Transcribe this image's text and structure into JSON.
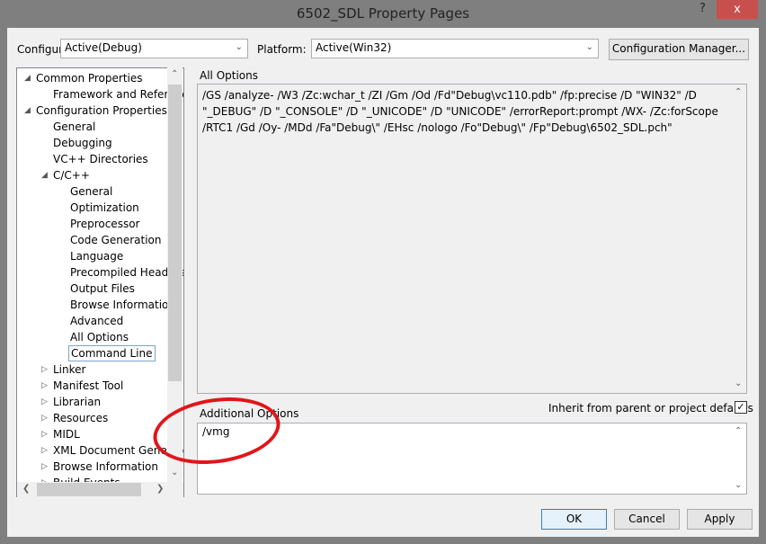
{
  "window": {
    "title": "6502_SDL Property Pages",
    "help": "?",
    "close": "x"
  },
  "toolbar": {
    "configuration_label": "Configuration:",
    "configuration_value": "Active(Debug)",
    "platform_label": "Platform:",
    "platform_value": "Active(Win32)",
    "config_manager": "Configuration Manager..."
  },
  "tree": {
    "items": [
      {
        "label": "Common Properties",
        "level": 0,
        "state": "expanded"
      },
      {
        "label": "Framework and References",
        "level": 1,
        "state": "leaf"
      },
      {
        "label": "Configuration Properties",
        "level": 0,
        "state": "expanded"
      },
      {
        "label": "General",
        "level": 1,
        "state": "leaf"
      },
      {
        "label": "Debugging",
        "level": 1,
        "state": "leaf"
      },
      {
        "label": "VC++ Directories",
        "level": 1,
        "state": "leaf"
      },
      {
        "label": "C/C++",
        "level": 1,
        "state": "expanded"
      },
      {
        "label": "General",
        "level": 2,
        "state": "leaf"
      },
      {
        "label": "Optimization",
        "level": 2,
        "state": "leaf"
      },
      {
        "label": "Preprocessor",
        "level": 2,
        "state": "leaf"
      },
      {
        "label": "Code Generation",
        "level": 2,
        "state": "leaf"
      },
      {
        "label": "Language",
        "level": 2,
        "state": "leaf"
      },
      {
        "label": "Precompiled Headers",
        "level": 2,
        "state": "leaf"
      },
      {
        "label": "Output Files",
        "level": 2,
        "state": "leaf"
      },
      {
        "label": "Browse Information",
        "level": 2,
        "state": "leaf"
      },
      {
        "label": "Advanced",
        "level": 2,
        "state": "leaf"
      },
      {
        "label": "All Options",
        "level": 2,
        "state": "leaf"
      },
      {
        "label": "Command Line",
        "level": 2,
        "state": "selected"
      },
      {
        "label": "Linker",
        "level": 1,
        "state": "collapsed"
      },
      {
        "label": "Manifest Tool",
        "level": 1,
        "state": "collapsed"
      },
      {
        "label": "Librarian",
        "level": 1,
        "state": "collapsed"
      },
      {
        "label": "Resources",
        "level": 1,
        "state": "collapsed"
      },
      {
        "label": "MIDL",
        "level": 1,
        "state": "collapsed"
      },
      {
        "label": "XML Document Generator",
        "level": 1,
        "state": "collapsed"
      },
      {
        "label": "Browse Information",
        "level": 1,
        "state": "collapsed"
      },
      {
        "label": "Build Events",
        "level": 1,
        "state": "collapsed"
      }
    ]
  },
  "main": {
    "all_options_label": "All Options",
    "all_options_text": "/GS /analyze- /W3 /Zc:wchar_t /ZI /Gm /Od /Fd\"Debug\\vc110.pdb\" /fp:precise /D \"WIN32\" /D \"_DEBUG\" /D \"_CONSOLE\" /D \"_UNICODE\" /D \"UNICODE\" /errorReport:prompt /WX- /Zc:forScope /RTC1 /Gd /Oy- /MDd /Fa\"Debug\\\" /EHsc /nologo /Fo\"Debug\\\" /Fp\"Debug\\6502_SDL.pch\"",
    "additional_label": "Additional Options",
    "additional_value": "/vmg",
    "inherit_label": "Inherit from parent or project defaults",
    "inherit_checked": true
  },
  "footer": {
    "ok": "OK",
    "cancel": "Cancel",
    "apply": "Apply"
  },
  "colors": {
    "close": "#c7504f",
    "annotation": "#e0161b",
    "selection_border": "#7da2ce",
    "focus": "#3c7fb1"
  }
}
